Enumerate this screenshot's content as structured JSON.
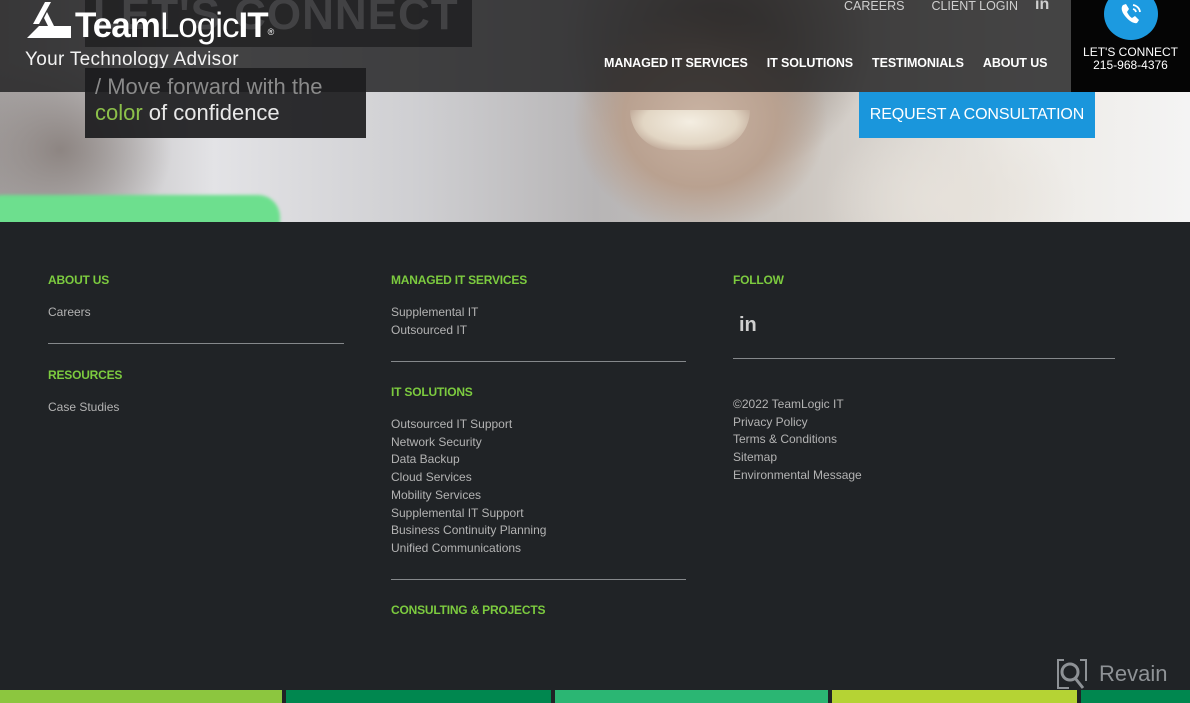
{
  "header": {
    "ghost_title": "LET'S CONNECT",
    "logo": {
      "bold": "Team",
      "light": "Logic",
      "suffix": "IT",
      "registered": "®"
    },
    "tagline": "Your Technology Advisor",
    "slogan": {
      "line1": "/ Move forward with the",
      "accent": "color",
      "line2_rest": " of confidence"
    },
    "utility_nav": [
      {
        "label": "CAREERS"
      },
      {
        "label": "CLIENT LOGIN"
      }
    ],
    "utility_social_icon": "linkedin-icon",
    "utility_social_label": "in",
    "main_nav": [
      {
        "label": "MANAGED IT SERVICES"
      },
      {
        "label": "IT SOLUTIONS"
      },
      {
        "label": "TESTIMONIALS"
      },
      {
        "label": "ABOUT US"
      }
    ],
    "connect": {
      "icon": "phone-icon",
      "label": "LET'S CONNECT",
      "phone": "215-968-4376"
    },
    "cta_label": "REQUEST A CONSULTATION"
  },
  "footer": {
    "columns": [
      {
        "sections": [
          {
            "title": "ABOUT US",
            "links": [
              "Careers"
            ]
          },
          {
            "title": "RESOURCES",
            "links": [
              "Case Studies"
            ]
          }
        ]
      },
      {
        "sections": [
          {
            "title": "MANAGED IT SERVICES",
            "links": [
              "Supplemental IT",
              "Outsourced IT"
            ]
          },
          {
            "title": "IT SOLUTIONS",
            "links": [
              "Outsourced IT Support",
              "Network Security",
              "Data Backup",
              "Cloud Services",
              "Mobility Services",
              "Supplemental IT Support",
              "Business Continuity Planning",
              "Unified Communications"
            ]
          },
          {
            "title": "CONSULTING & PROJECTS",
            "links": []
          }
        ]
      },
      {
        "sections": [
          {
            "title": "FOLLOW",
            "social_icon": "linkedin-icon",
            "social_label": "in"
          }
        ],
        "legal": [
          "©2022 TeamLogic IT",
          "Privacy Policy",
          "Terms & Conditions",
          "Sitemap",
          "Environmental Message"
        ]
      }
    ]
  },
  "watermark": {
    "icon": "revain-logo-icon",
    "label": "Revain"
  },
  "colors": {
    "accent_green": "#7ccb3f",
    "cta_blue": "#1a96dc",
    "footer_bg": "#202326",
    "bottom_bars": [
      "#8cc63f",
      "#00874f",
      "#2bb673",
      "#b5d334",
      "#00874f"
    ]
  }
}
